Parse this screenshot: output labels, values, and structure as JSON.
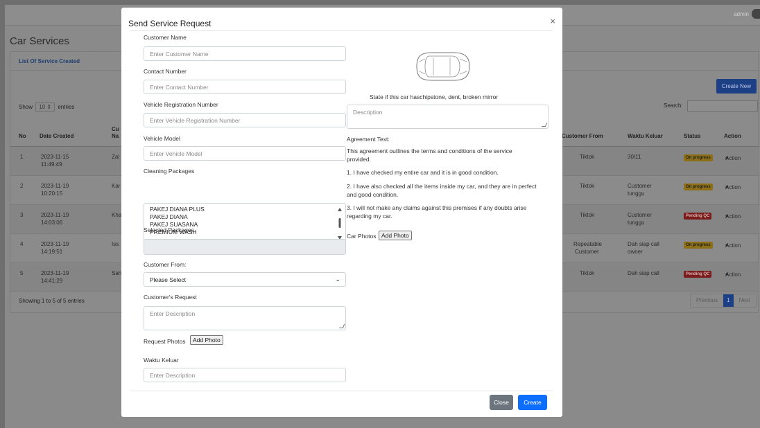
{
  "background": {
    "user_label": "admin",
    "page_title": "Car Services",
    "card_title": "List Of Service Created",
    "create_new": "Create New",
    "show": "Show",
    "entries_value": "10",
    "entries": "entries",
    "search": "Search:",
    "columns_left": [
      "No",
      "Date Created",
      "Cu Na"
    ],
    "columns_right": [
      "Customer From",
      "Waktu Keluar",
      "Status",
      "Action"
    ],
    "rows": [
      {
        "no": "1",
        "date": "2023-11-15",
        "time": "11:49:49",
        "name": "Zal",
        "from": "Tiktok",
        "from2": "",
        "keluar": "30/11",
        "keluar2": "",
        "status": "On progress",
        "action": "Action"
      },
      {
        "no": "2",
        "date": "2023-11-19",
        "time": "10:20:15",
        "name": "Kar",
        "from": "Tiktok",
        "from2": "",
        "keluar": "Customer",
        "keluar2": "tunggu",
        "status": "On progress",
        "action": "Action"
      },
      {
        "no": "3",
        "date": "2023-11-19",
        "time": "14:03:06",
        "name": "Kha",
        "from": "Tiktok",
        "from2": "",
        "keluar": "Customer",
        "keluar2": "tunggu",
        "status": "Pending QC",
        "action": "Action"
      },
      {
        "no": "4",
        "date": "2023-11-19",
        "time": "14:19:51",
        "name": "Iss",
        "from": "Repeatable",
        "from2": "Customer",
        "keluar": "Dah siap call",
        "keluar2": "owner",
        "status": "On progress",
        "action": "Action"
      },
      {
        "no": "5",
        "date": "2023-11-19",
        "time": "14:41:29",
        "name": "Sah",
        "from": "Tiktok",
        "from2": "",
        "keluar": "Dah siap call",
        "keluar2": "",
        "status": "Pending QC",
        "action": "Action"
      }
    ],
    "showing": "Showing 1 to 5 of 5 entries",
    "pager": {
      "previous": "Previous",
      "page": "1",
      "next": "Next"
    }
  },
  "modal": {
    "title": "Send Service Request",
    "close_icon": "×",
    "customer_name_label": "Customer Name",
    "customer_name_placeholder": "Enter Customer Name",
    "contact_label": "Contact Number",
    "contact_placeholder": "Enter Contact Number",
    "vehicle_reg_label": "Vehicle Registration Number",
    "vehicle_reg_placeholder": "Enter Vehicle Registration Number",
    "vehicle_model_label": "Vehicle Model",
    "vehicle_model_placeholder": "Enter Vehicle Model",
    "packages_label": "Cleaning Packages",
    "packages": [
      "PAKEJ DIANA PLUS",
      "PAKEJ DIANA",
      "PAKEJ SUASANA",
      "PREMIUM WASH"
    ],
    "selected_packages_label": "Selected Packages",
    "customer_from_label": "Customer From:",
    "customer_from_value": "Please Select",
    "request_label": "Customer's Request",
    "request_placeholder": "Enter Description",
    "request_photos_label": "Request Photos",
    "add_photo": "Add Photo",
    "waktu_label": "Waktu Keluar",
    "waktu_placeholder": "Enter Description",
    "car_state_text": "State if this car haschipstone, dent, broken mirror",
    "description_placeholder": "Description",
    "agreement_title": "Agreement Text:",
    "agreement_intro_1": "This agreement outlines the terms and conditions of the service",
    "agreement_intro_2": "provided.",
    "agreement_1": "1. I have checked my entire car and it is in good condition.",
    "agreement_2a": "2. I have also checked all the items inside my car, and they are in perfect",
    "agreement_2b": "and good condition.",
    "agreement_3a": "3. I will not make any claims against this premises if any doubts arise",
    "agreement_3b": "regarding my car.",
    "car_photos_label": "Car Photos",
    "close_btn": "Close",
    "create_btn": "Create"
  }
}
